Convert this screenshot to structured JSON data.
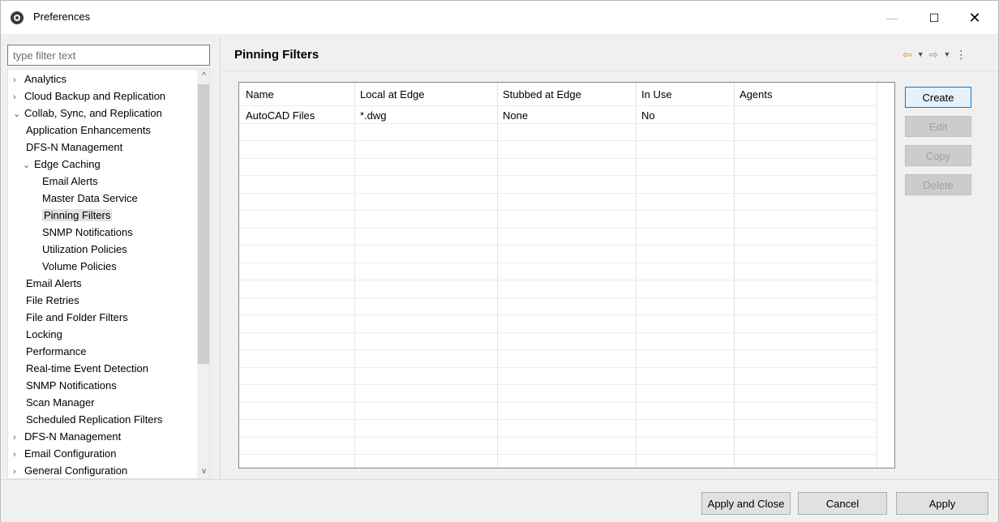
{
  "window": {
    "title": "Preferences",
    "controls": {
      "minimize": "—",
      "maximize": "☐",
      "close": "✕"
    }
  },
  "sidebar": {
    "filter_placeholder": "type filter text",
    "tree": [
      {
        "label": "Analytics",
        "twisty": "›",
        "level": 0
      },
      {
        "label": "Cloud Backup and Replication",
        "twisty": "›",
        "level": 0
      },
      {
        "label": "Collab, Sync, and Replication",
        "twisty": "⌄",
        "level": 0
      },
      {
        "label": "Application Enhancements",
        "twisty": "",
        "level": 1
      },
      {
        "label": "DFS-N Management",
        "twisty": "",
        "level": 1
      },
      {
        "label": "Edge Caching",
        "twisty": "⌄",
        "level": 1
      },
      {
        "label": "Email Alerts",
        "twisty": "",
        "level": 2
      },
      {
        "label": "Master Data Service",
        "twisty": "",
        "level": 2
      },
      {
        "label": "Pinning Filters",
        "twisty": "",
        "level": 2,
        "selected": true
      },
      {
        "label": "SNMP Notifications",
        "twisty": "",
        "level": 2
      },
      {
        "label": "Utilization Policies",
        "twisty": "",
        "level": 2
      },
      {
        "label": "Volume Policies",
        "twisty": "",
        "level": 2
      },
      {
        "label": "Email Alerts",
        "twisty": "",
        "level": 1
      },
      {
        "label": "File Retries",
        "twisty": "",
        "level": 1
      },
      {
        "label": "File and Folder Filters",
        "twisty": "",
        "level": 1
      },
      {
        "label": "Locking",
        "twisty": "",
        "level": 1
      },
      {
        "label": "Performance",
        "twisty": "",
        "level": 1
      },
      {
        "label": "Real-time Event Detection",
        "twisty": "",
        "level": 1
      },
      {
        "label": "SNMP Notifications",
        "twisty": "",
        "level": 1
      },
      {
        "label": "Scan Manager",
        "twisty": "",
        "level": 1
      },
      {
        "label": "Scheduled Replication Filters",
        "twisty": "",
        "level": 1
      },
      {
        "label": "DFS-N Management",
        "twisty": "›",
        "level": 0
      },
      {
        "label": "Email Configuration",
        "twisty": "›",
        "level": 0
      },
      {
        "label": "General Configuration",
        "twisty": "›",
        "level": 0
      }
    ]
  },
  "main": {
    "title": "Pinning Filters",
    "table": {
      "columns": [
        "Name",
        "Local at Edge",
        "Stubbed at Edge",
        "In Use",
        "Agents"
      ],
      "rows": [
        [
          "AutoCAD Files",
          "*.dwg",
          "None",
          "No",
          ""
        ]
      ]
    },
    "side_buttons": {
      "create": "Create",
      "edit": "Edit",
      "copy": "Copy",
      "delete": "Delete"
    }
  },
  "footer": {
    "apply_and_close": "Apply and Close",
    "cancel": "Cancel",
    "apply": "Apply"
  }
}
